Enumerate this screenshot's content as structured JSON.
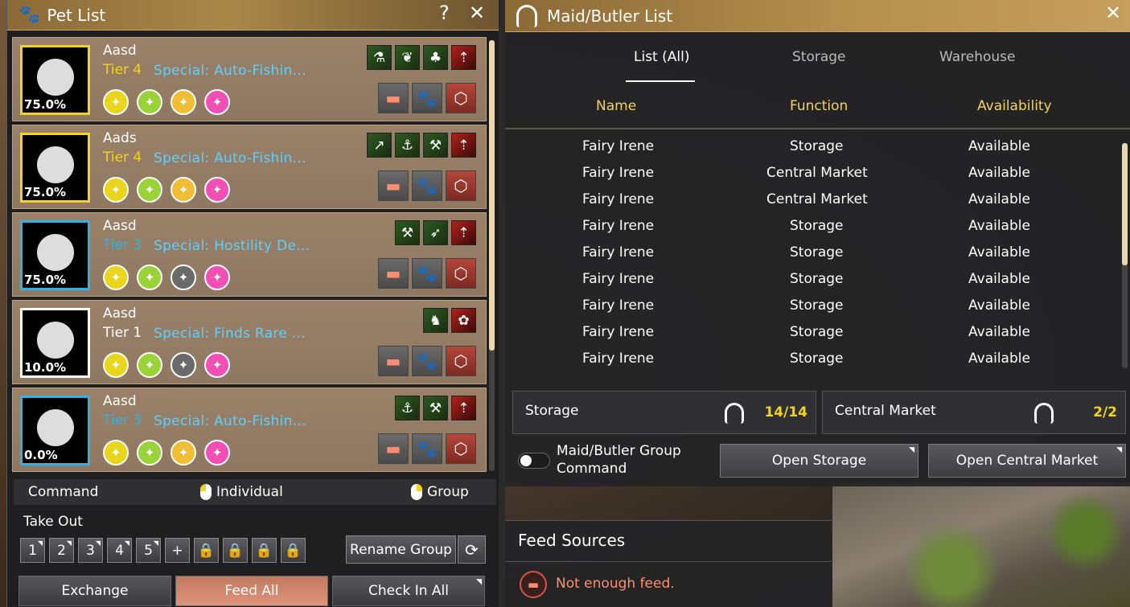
{
  "pet_list": {
    "title": "Pet List",
    "help_label": "?",
    "close_label": "✕",
    "pets": [
      {
        "name": "Aasd",
        "tier": "Tier 4",
        "tier_color": "#f4d31c",
        "special": "Special: Auto-Fishin...",
        "hunger": "75.0%",
        "frame": "gold",
        "talents": [
          "⚗",
          "❦",
          "♣",
          "⇡"
        ],
        "skills": [
          "yellow",
          "green",
          "orange",
          "pink"
        ]
      },
      {
        "name": "Aads",
        "tier": "Tier 4",
        "tier_color": "#f4d31c",
        "special": "Special: Auto-Fishin...",
        "hunger": "75.0%",
        "frame": "gold",
        "talents": [
          "↗",
          "⚓",
          "⚒",
          "⇡"
        ],
        "skills": [
          "yellow",
          "green",
          "orange",
          "pink"
        ]
      },
      {
        "name": "Aasd",
        "tier": "Tier 3",
        "tier_color": "#2ab5e6",
        "special": "Special: Hostility De...",
        "hunger": "75.0%",
        "frame": "blue",
        "talents": [
          "⚒",
          "➶",
          "⇡"
        ],
        "skills": [
          "yellow",
          "green",
          "grey",
          "pink"
        ]
      },
      {
        "name": "Aasd",
        "tier": "Tier 1",
        "tier_color": "#ffffff",
        "special": "Special: Finds Rare ...",
        "hunger": "10.0%",
        "frame": "white",
        "talents": [
          "♞",
          "✿"
        ],
        "skills": [
          "yellow",
          "green",
          "grey",
          "pink"
        ]
      },
      {
        "name": "Aasd",
        "tier": "Tier 3",
        "tier_color": "#2ab5e6",
        "special": "Special: Auto-Fishin...",
        "hunger": "0.0%",
        "frame": "blue",
        "talents": [
          "⚓",
          "⚒",
          "⇡"
        ],
        "skills": [
          "yellow",
          "green",
          "orange",
          "pink"
        ]
      }
    ],
    "command_label": "Command",
    "individual_label": "Individual",
    "group_label": "Group",
    "take_out_label": "Take Out",
    "slots": [
      "1",
      "2",
      "3",
      "4",
      "5",
      "+",
      "🔒",
      "🔒",
      "🔒",
      "🔒"
    ],
    "rename_group_label": "Rename Group",
    "exchange_label": "Exchange",
    "feed_all_label": "Feed All",
    "check_in_all_label": "Check In All"
  },
  "maid_list": {
    "title": "Maid/Butler List",
    "close_label": "✕",
    "tabs": [
      "List (All)",
      "Storage",
      "Warehouse"
    ],
    "active_tab": "List (All)",
    "columns": [
      "Name",
      "Function",
      "Availability"
    ],
    "rows": [
      {
        "name": "Fairy Irene",
        "function": "Storage",
        "availability": "Available"
      },
      {
        "name": "Fairy Irene",
        "function": "Central Market",
        "availability": "Available"
      },
      {
        "name": "Fairy Irene",
        "function": "Central Market",
        "availability": "Available"
      },
      {
        "name": "Fairy Irene",
        "function": "Storage",
        "availability": "Available"
      },
      {
        "name": "Fairy Irene",
        "function": "Storage",
        "availability": "Available"
      },
      {
        "name": "Fairy Irene",
        "function": "Storage",
        "availability": "Available"
      },
      {
        "name": "Fairy Irene",
        "function": "Storage",
        "availability": "Available"
      },
      {
        "name": "Fairy Irene",
        "function": "Storage",
        "availability": "Available"
      },
      {
        "name": "Fairy Irene",
        "function": "Storage",
        "availability": "Available"
      }
    ],
    "storage_label": "Storage",
    "storage_count": "14/14",
    "market_label": "Central Market",
    "market_count": "2/2",
    "group_command_line1": "Maid/Butler Group",
    "group_command_line2": "Command",
    "open_storage_label": "Open Storage",
    "open_market_label": "Open Central Market"
  },
  "feed_sources": {
    "title": "Feed Sources",
    "message": "Not enough feed."
  }
}
